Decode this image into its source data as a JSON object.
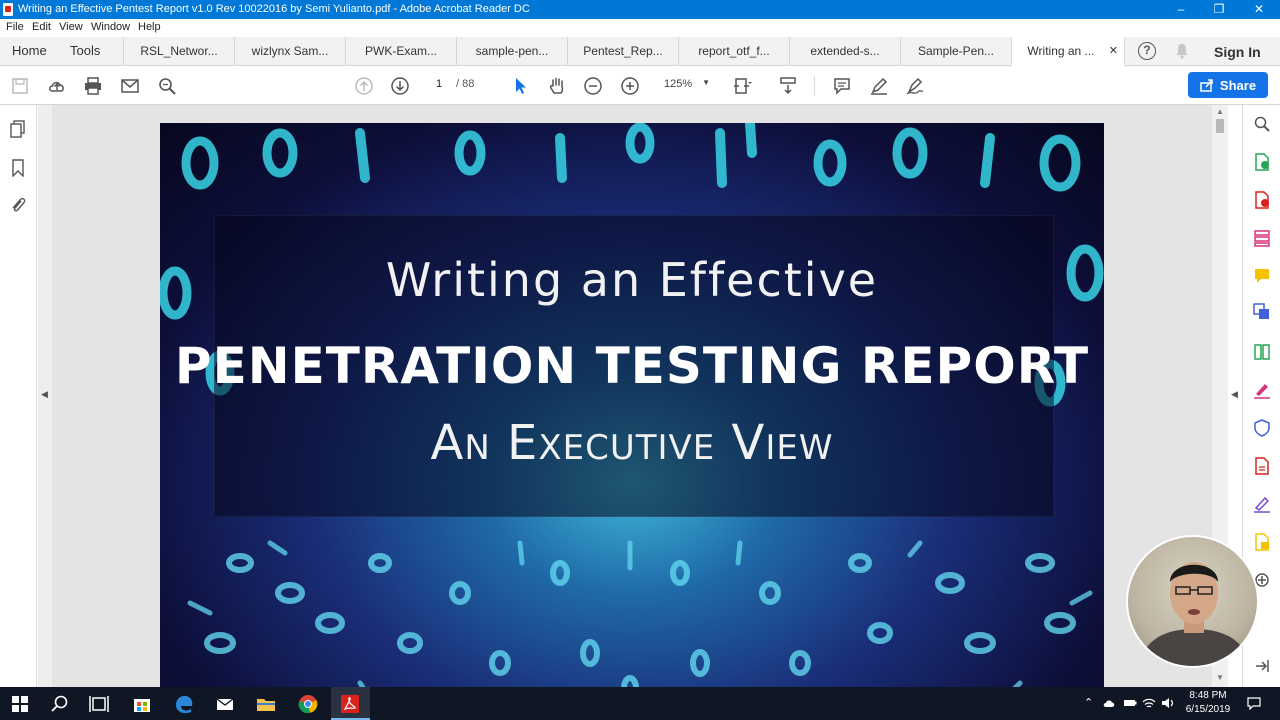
{
  "window": {
    "title": "Writing an Effective Pentest Report v1.0 Rev 10022016 by Semi Yulianto.pdf - Adobe Acrobat Reader DC"
  },
  "menu": [
    "File",
    "Edit",
    "View",
    "Window",
    "Help"
  ],
  "nav": {
    "home": "Home",
    "tools": "Tools",
    "signin": "Sign In"
  },
  "tabs": [
    "RSL_Networ...",
    "wizlynx Sam...",
    "PWK-Exam...",
    "sample-pen...",
    "Pentest_Rep...",
    "report_otf_f...",
    "extended-s...",
    "Sample-Pen...",
    "Writing an ..."
  ],
  "toolbar": {
    "page_current": "1",
    "page_total": "/ 88",
    "zoom": "125%",
    "share": "Share"
  },
  "document": {
    "line1": "Writing an Effective",
    "line2": "PENETRATION TESTING REPORT",
    "line3": "An Executive View"
  },
  "taskbar": {
    "time": "8:48 PM",
    "date": "6/15/2019"
  },
  "colors": {
    "titlebar": "#0078d7",
    "share": "#1473e6",
    "acrobat_red": "#d9221c",
    "taskbar": "#101724"
  }
}
